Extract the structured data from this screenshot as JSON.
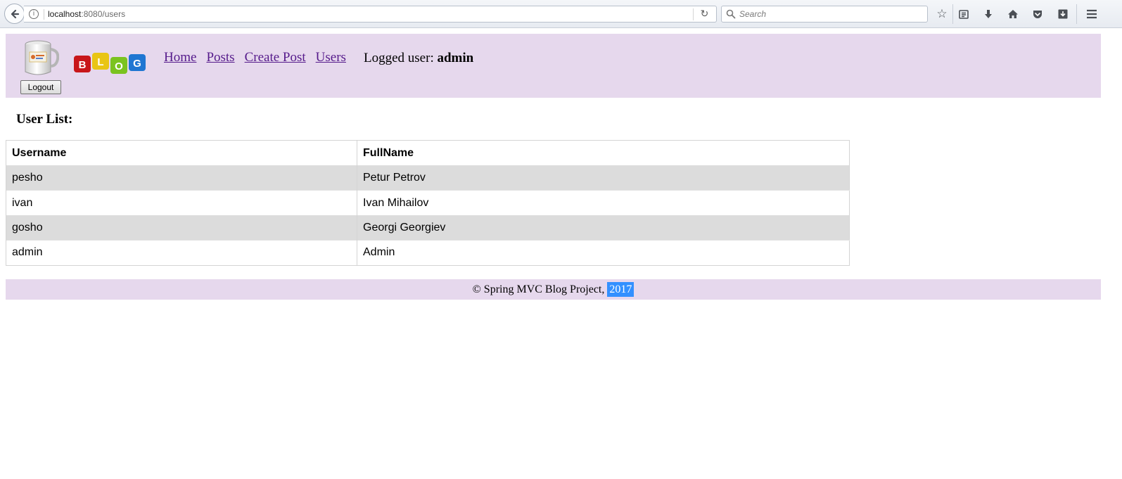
{
  "browser": {
    "url_host": "localhost",
    "url_path": ":8080/users",
    "search_placeholder": "Search"
  },
  "header": {
    "logout_label": "Logout",
    "logo_text": [
      "B",
      "L",
      "O",
      "G"
    ],
    "nav": [
      {
        "label": "Home"
      },
      {
        "label": "Posts"
      },
      {
        "label": "Create Post"
      },
      {
        "label": "Users"
      }
    ],
    "logged_user_prefix": "Logged user:",
    "logged_user_name": "admin"
  },
  "main": {
    "title": "User List:",
    "columns": [
      "Username",
      "FullName"
    ],
    "rows": [
      {
        "username": "pesho",
        "fullname": "Petur Petrov"
      },
      {
        "username": "ivan",
        "fullname": "Ivan Mihailov"
      },
      {
        "username": "gosho",
        "fullname": "Georgi Georgiev"
      },
      {
        "username": "admin",
        "fullname": "Admin"
      }
    ]
  },
  "footer": {
    "text": "© Spring MVC Blog Project,",
    "year": "2017"
  },
  "colors": {
    "header_bg": "#e6d8ed",
    "link": "#551a8b",
    "row_stripe": "#dcdcdc",
    "selection": "#3390ff"
  }
}
